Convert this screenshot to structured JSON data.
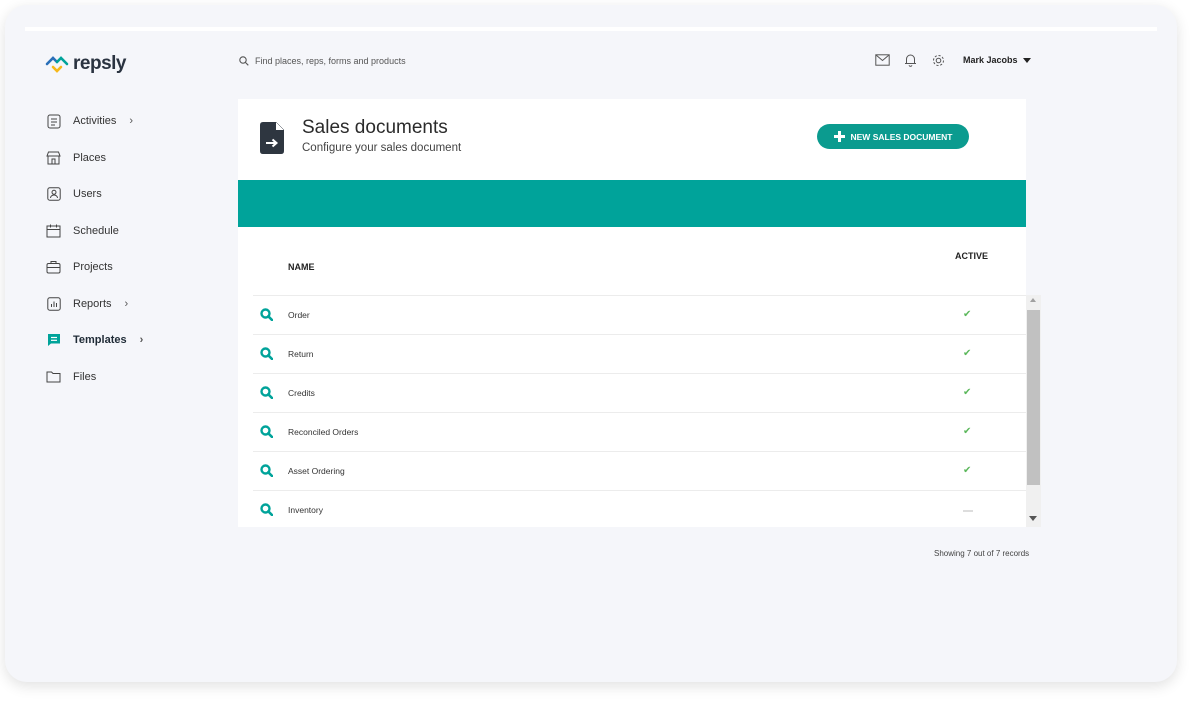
{
  "brand": {
    "name": "repsly"
  },
  "search": {
    "placeholder": "Find places, reps, forms and products"
  },
  "header": {
    "icons": [
      "mail-icon",
      "bell-icon",
      "gear-icon"
    ],
    "user_name": "Mark Jacobs"
  },
  "sidebar": {
    "items": [
      {
        "label": "Activities",
        "icon": "clipboard-icon",
        "has_chevron": true
      },
      {
        "label": "Places",
        "icon": "store-icon",
        "has_chevron": false
      },
      {
        "label": "Users",
        "icon": "user-icon",
        "has_chevron": false
      },
      {
        "label": "Schedule",
        "icon": "calendar-icon",
        "has_chevron": false
      },
      {
        "label": "Projects",
        "icon": "briefcase-icon",
        "has_chevron": false
      },
      {
        "label": "Reports",
        "icon": "bar-chart-icon",
        "has_chevron": true
      },
      {
        "label": "Templates",
        "icon": "template-icon",
        "has_chevron": true,
        "active": true
      },
      {
        "label": "Files",
        "icon": "folder-icon",
        "has_chevron": false
      }
    ]
  },
  "page": {
    "title": "Sales documents",
    "subtitle": "Configure your sales document",
    "new_button_label": "NEW SALES DOCUMENT",
    "accent_color": "#00a39a"
  },
  "table": {
    "columns": {
      "name": "NAME",
      "active": "ACTIVE"
    },
    "rows": [
      {
        "name": "Order",
        "active": true
      },
      {
        "name": "Return",
        "active": true
      },
      {
        "name": "Credits",
        "active": true
      },
      {
        "name": "Reconciled Orders",
        "active": true
      },
      {
        "name": "Asset Ordering",
        "active": true
      },
      {
        "name": "Inventory",
        "active": false
      }
    ],
    "check_glyph": "✔"
  },
  "footer": {
    "records_text": "Showing 7 out of 7 records"
  }
}
